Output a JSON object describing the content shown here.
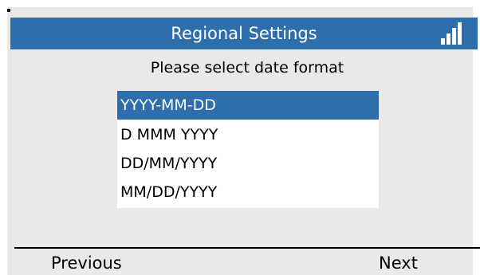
{
  "title_bar": {
    "title": "Regional Settings",
    "signal_icon": "signal-strength-icon"
  },
  "prompt": "Please select date format",
  "date_formats": {
    "selected_index": 0,
    "options": [
      "YYYY-MM-DD",
      "D MMM YYYY",
      "DD/MM/YYYY",
      "MM/DD/YYYY"
    ]
  },
  "softkeys": {
    "left": "Previous",
    "right": "Next"
  },
  "colors": {
    "accent": "#2f6ead",
    "screen_background": "#e9e9e9",
    "list_background": "#ffffff"
  }
}
